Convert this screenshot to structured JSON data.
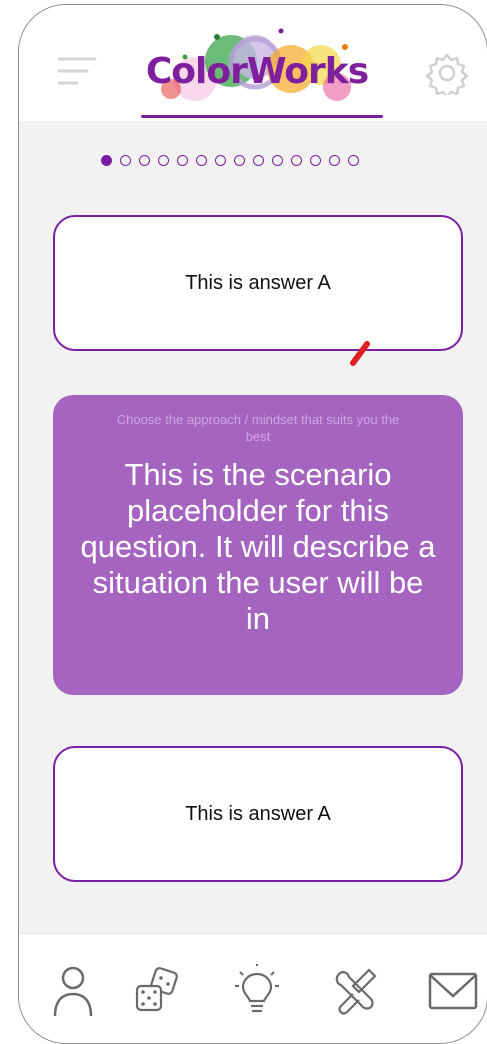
{
  "header": {
    "logo_text": "ColorWorks",
    "accent_color": "#7b1fa2",
    "menu_icon": "menu-icon",
    "settings_icon": "gear-icon"
  },
  "pager": {
    "total": 14,
    "current": 1
  },
  "answers": [
    {
      "label": "This is answer A"
    },
    {
      "label": "This is answer A"
    }
  ],
  "scenario": {
    "hint": "Choose the approach / mindset that suits you the best",
    "text": "This is the scenario placeholder for this question. It will describe a situation the user will be in",
    "background_color": "#a564bf"
  },
  "nav": {
    "items": [
      {
        "icon": "profile-icon"
      },
      {
        "icon": "dice-icon"
      },
      {
        "icon": "lightbulb-icon"
      },
      {
        "icon": "tools-icon"
      },
      {
        "icon": "mail-icon"
      }
    ]
  }
}
